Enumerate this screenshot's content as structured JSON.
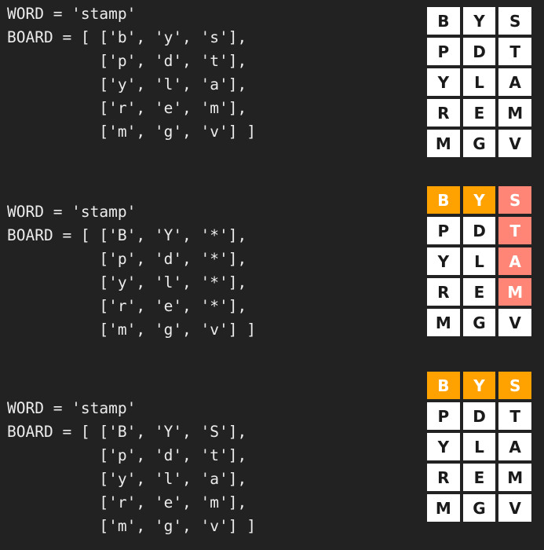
{
  "colors": {
    "background": "#222222",
    "code_text": "#ececec",
    "cell_default": "#ffffff",
    "cell_found": "#ff8577",
    "cell_used": "#ffa200"
  },
  "examples": [
    {
      "code": [
        "WORD = 'stamp'",
        "BOARD = [ ['b', 'y', 's'],",
        "          ['p', 'd', 't'],",
        "          ['y', 'l', 'a'],",
        "          ['r', 'e', 'm'],",
        "          ['m', 'g', 'v'] ]"
      ],
      "grid": [
        [
          {
            "letter": "B",
            "state": "default"
          },
          {
            "letter": "Y",
            "state": "default"
          },
          {
            "letter": "S",
            "state": "default"
          }
        ],
        [
          {
            "letter": "P",
            "state": "default"
          },
          {
            "letter": "D",
            "state": "default"
          },
          {
            "letter": "T",
            "state": "default"
          }
        ],
        [
          {
            "letter": "Y",
            "state": "default"
          },
          {
            "letter": "L",
            "state": "default"
          },
          {
            "letter": "A",
            "state": "default"
          }
        ],
        [
          {
            "letter": "R",
            "state": "default"
          },
          {
            "letter": "E",
            "state": "default"
          },
          {
            "letter": "M",
            "state": "default"
          }
        ],
        [
          {
            "letter": "M",
            "state": "default"
          },
          {
            "letter": "G",
            "state": "default"
          },
          {
            "letter": "V",
            "state": "default"
          }
        ]
      ]
    },
    {
      "code": [
        "WORD = 'stamp'",
        "BOARD = [ ['B', 'Y', '*'],",
        "          ['p', 'd', '*'],",
        "          ['y', 'l', '*'],",
        "          ['r', 'e', '*'],",
        "          ['m', 'g', 'v'] ]"
      ],
      "grid": [
        [
          {
            "letter": "B",
            "state": "used"
          },
          {
            "letter": "Y",
            "state": "used"
          },
          {
            "letter": "S",
            "state": "found"
          }
        ],
        [
          {
            "letter": "P",
            "state": "default"
          },
          {
            "letter": "D",
            "state": "default"
          },
          {
            "letter": "T",
            "state": "found"
          }
        ],
        [
          {
            "letter": "Y",
            "state": "default"
          },
          {
            "letter": "L",
            "state": "default"
          },
          {
            "letter": "A",
            "state": "found"
          }
        ],
        [
          {
            "letter": "R",
            "state": "default"
          },
          {
            "letter": "E",
            "state": "default"
          },
          {
            "letter": "M",
            "state": "found"
          }
        ],
        [
          {
            "letter": "M",
            "state": "default"
          },
          {
            "letter": "G",
            "state": "default"
          },
          {
            "letter": "V",
            "state": "default"
          }
        ]
      ]
    },
    {
      "code": [
        "WORD = 'stamp'",
        "BOARD = [ ['B', 'Y', 'S'],",
        "          ['p', 'd', 't'],",
        "          ['y', 'l', 'a'],",
        "          ['r', 'e', 'm'],",
        "          ['m', 'g', 'v'] ]"
      ],
      "grid": [
        [
          {
            "letter": "B",
            "state": "used"
          },
          {
            "letter": "Y",
            "state": "used"
          },
          {
            "letter": "S",
            "state": "used"
          }
        ],
        [
          {
            "letter": "P",
            "state": "default"
          },
          {
            "letter": "D",
            "state": "default"
          },
          {
            "letter": "T",
            "state": "default"
          }
        ],
        [
          {
            "letter": "Y",
            "state": "default"
          },
          {
            "letter": "L",
            "state": "default"
          },
          {
            "letter": "A",
            "state": "default"
          }
        ],
        [
          {
            "letter": "R",
            "state": "default"
          },
          {
            "letter": "E",
            "state": "default"
          },
          {
            "letter": "M",
            "state": "default"
          }
        ],
        [
          {
            "letter": "M",
            "state": "default"
          },
          {
            "letter": "G",
            "state": "default"
          },
          {
            "letter": "V",
            "state": "default"
          }
        ]
      ]
    }
  ]
}
